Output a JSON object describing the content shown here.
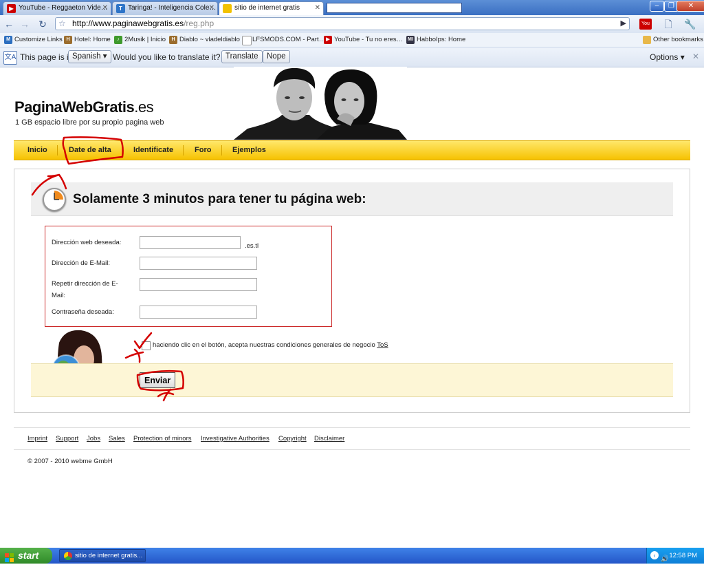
{
  "browser": {
    "tabs": [
      {
        "title": "YouTube - Reggaeton Vide…",
        "favicon": "youtube-icon",
        "color": "#cc0000"
      },
      {
        "title": "Taringa! - Inteligencia Cole…",
        "favicon": "taringa-icon",
        "color": "#2d74c8"
      },
      {
        "title": "sitio de internet gratis",
        "favicon": "page-icon",
        "color": "#f2c200"
      }
    ],
    "url_host": "http://www.paginawebgratis.es",
    "url_path": "/reg.php",
    "bookmarks": [
      "Customize Links",
      "Hotel: Home",
      "2Musik | Inicio",
      "Diablo ~ vladeldiablo",
      "LFSMODS.COM - Part…",
      "YouTube - Tu no eres…",
      "HabboIps: Home"
    ],
    "other_bookmarks": "Other bookmarks"
  },
  "translate_bar": {
    "prefix": "This page is in",
    "language": "Spanish",
    "question": "Would you like to translate it?",
    "translate_label": "Translate",
    "nope_label": "Nope",
    "options_label": "Options"
  },
  "site": {
    "logo_main": "PaginaWebGratis",
    "logo_tld": ".es",
    "tagline": "1 GB espacio libre por su propio pagina web",
    "nav": [
      "Inicio",
      "Date de alta",
      "Identificate",
      "Foro",
      "Ejemplos"
    ],
    "heading": "Solamente 3 minutos para tener tu página web:",
    "form": {
      "web_label": "Dirección web deseada:",
      "web_suffix": ".es.tl",
      "email_label": "Dirección de E-Mail:",
      "repeat_label_line1": "Repetir dirección de E-",
      "repeat_label_line2": "Mail:",
      "password_label": "Contraseña deseada:"
    },
    "terms_text": "haciendo clic en el botón, acepta nuestras condiciones generales de negocio",
    "terms_link": "ToS",
    "submit_label": "Enviar",
    "footer_links": [
      "Imprint",
      "Support",
      "Jobs",
      "Sales",
      "Protection of minors",
      "Investigative Authorities",
      "Copyright",
      "Disclaimer"
    ],
    "copyright": "© 2007 - 2010 webme GmbH"
  },
  "taskbar": {
    "start_label": "start",
    "task_item": "sitio de internet gratis...",
    "clock": "12:58 PM"
  },
  "colors": {
    "navbar_yellow": "#f6c200",
    "annotation_red": "#d40000",
    "taskbar_blue": "#2456c8"
  }
}
